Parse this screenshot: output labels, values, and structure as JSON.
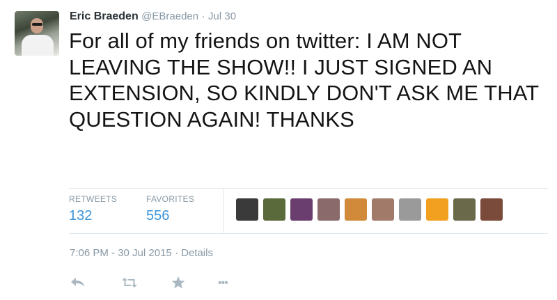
{
  "user": {
    "name": "Eric Braeden",
    "handle": "@EBraeden",
    "separator": "·",
    "date": "Jul 30"
  },
  "tweet": {
    "text": "For all of my friends on twitter: I AM NOT LEAVING THE SHOW!! I JUST SIGNED AN EXTENSION, SO KINDLY DON'T ASK ME THAT QUESTION AGAIN! THANKS"
  },
  "stats": {
    "retweets_label": "RETWEETS",
    "retweets_count": "132",
    "favorites_label": "FAVORITES",
    "favorites_count": "556"
  },
  "favoriters": [
    {
      "name": "favoriter-avatar-1",
      "color": "#3a3a3a"
    },
    {
      "name": "favoriter-avatar-2",
      "color": "#5a6a3a"
    },
    {
      "name": "favoriter-avatar-3",
      "color": "#6a3e6e"
    },
    {
      "name": "favoriter-avatar-4",
      "color": "#8a6a6a"
    },
    {
      "name": "favoriter-avatar-5",
      "color": "#d08a3a"
    },
    {
      "name": "favoriter-avatar-6",
      "color": "#a27a6a"
    },
    {
      "name": "favoriter-avatar-7",
      "color": "#9a9a9a"
    },
    {
      "name": "favoriter-avatar-8",
      "color": "#f2a020"
    },
    {
      "name": "favoriter-avatar-9",
      "color": "#6a6a4a"
    },
    {
      "name": "favoriter-avatar-10",
      "color": "#7a4a3a"
    }
  ],
  "meta": {
    "timestamp": "7:06 PM - 30 Jul 2015",
    "separator": "·",
    "details_link": "Details"
  },
  "actions": {
    "more_label": "•••"
  },
  "colors": {
    "link": "#3b94d9",
    "muted": "#8899a6",
    "icon": "#aab8c2"
  }
}
